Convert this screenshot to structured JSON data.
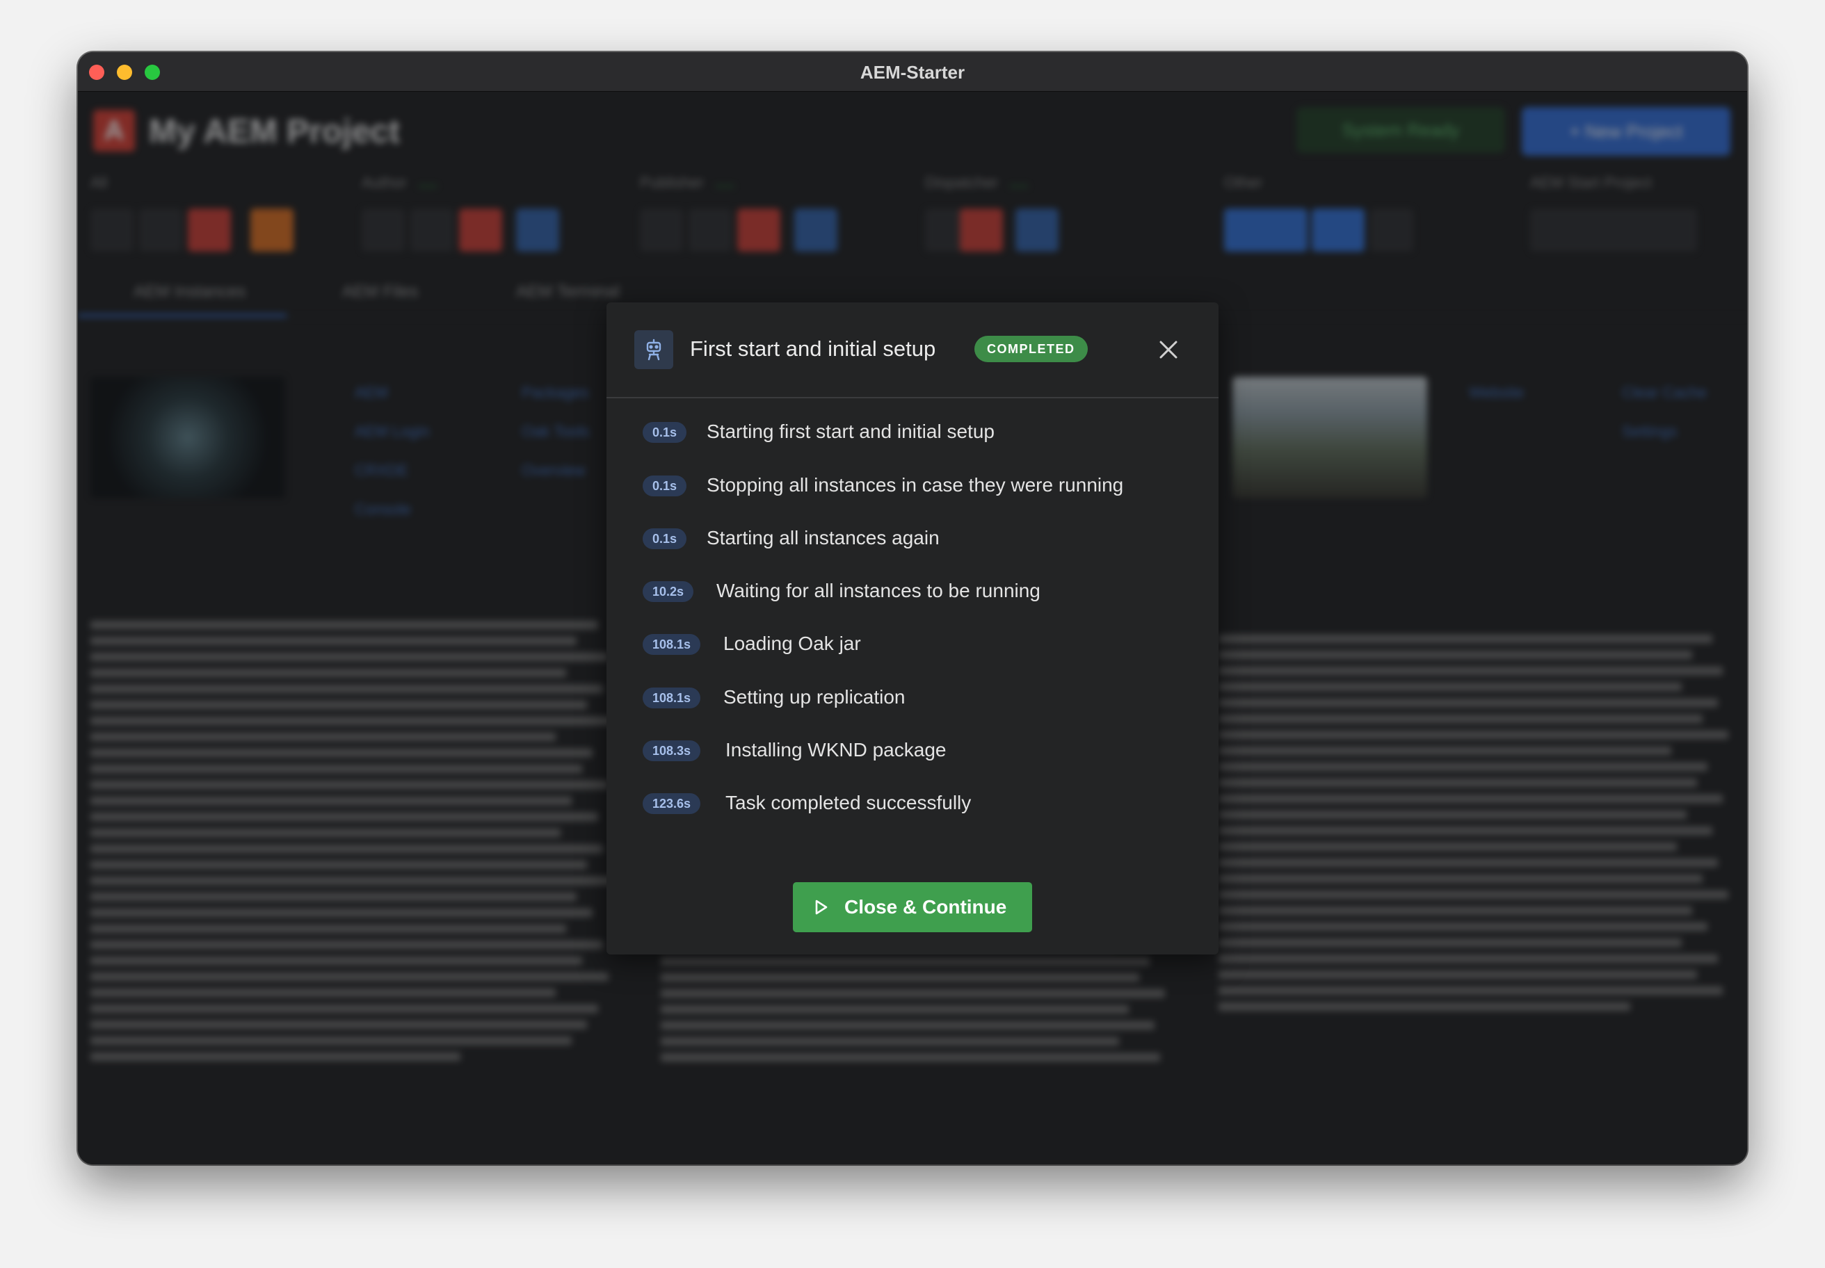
{
  "window": {
    "title": "AEM-Starter"
  },
  "background": {
    "logo_letter": "A",
    "project_title": "My AEM Project",
    "system_status": "System Ready",
    "new_project": "+ New Project",
    "groups": [
      "All",
      "Author",
      "Publisher",
      "Dispatcher",
      "Other",
      "AEM Start Project"
    ],
    "tabs": [
      "AEM Instances",
      "AEM Files",
      "AEM Terminal"
    ],
    "links_left": [
      "AEM",
      "AEM Login",
      "CRXDE",
      "Console"
    ],
    "links_left2": [
      "Packages",
      "Oak Tools",
      "Overview"
    ],
    "links_right": [
      "Website",
      "Clear Cache",
      "Settings"
    ]
  },
  "modal": {
    "title": "First start and initial setup",
    "status_badge": "COMPLETED",
    "steps": [
      {
        "time": "0.1s",
        "text": "Starting first start and initial setup"
      },
      {
        "time": "0.1s",
        "text": "Stopping all instances in case they were running"
      },
      {
        "time": "0.1s",
        "text": "Starting all instances again"
      },
      {
        "time": "10.2s",
        "text": "Waiting for all instances to be running"
      },
      {
        "time": "108.1s",
        "text": "Loading Oak jar"
      },
      {
        "time": "108.1s",
        "text": "Setting up replication"
      },
      {
        "time": "108.3s",
        "text": "Installing WKND package"
      },
      {
        "time": "123.6s",
        "text": "Task completed successfully"
      }
    ],
    "continue_label": "Close & Continue"
  },
  "colors": {
    "accent_green": "#3f9f4e",
    "badge_green": "#3d8c48",
    "time_pill": "#2b3a55",
    "primary_blue": "#2e6bd8"
  }
}
